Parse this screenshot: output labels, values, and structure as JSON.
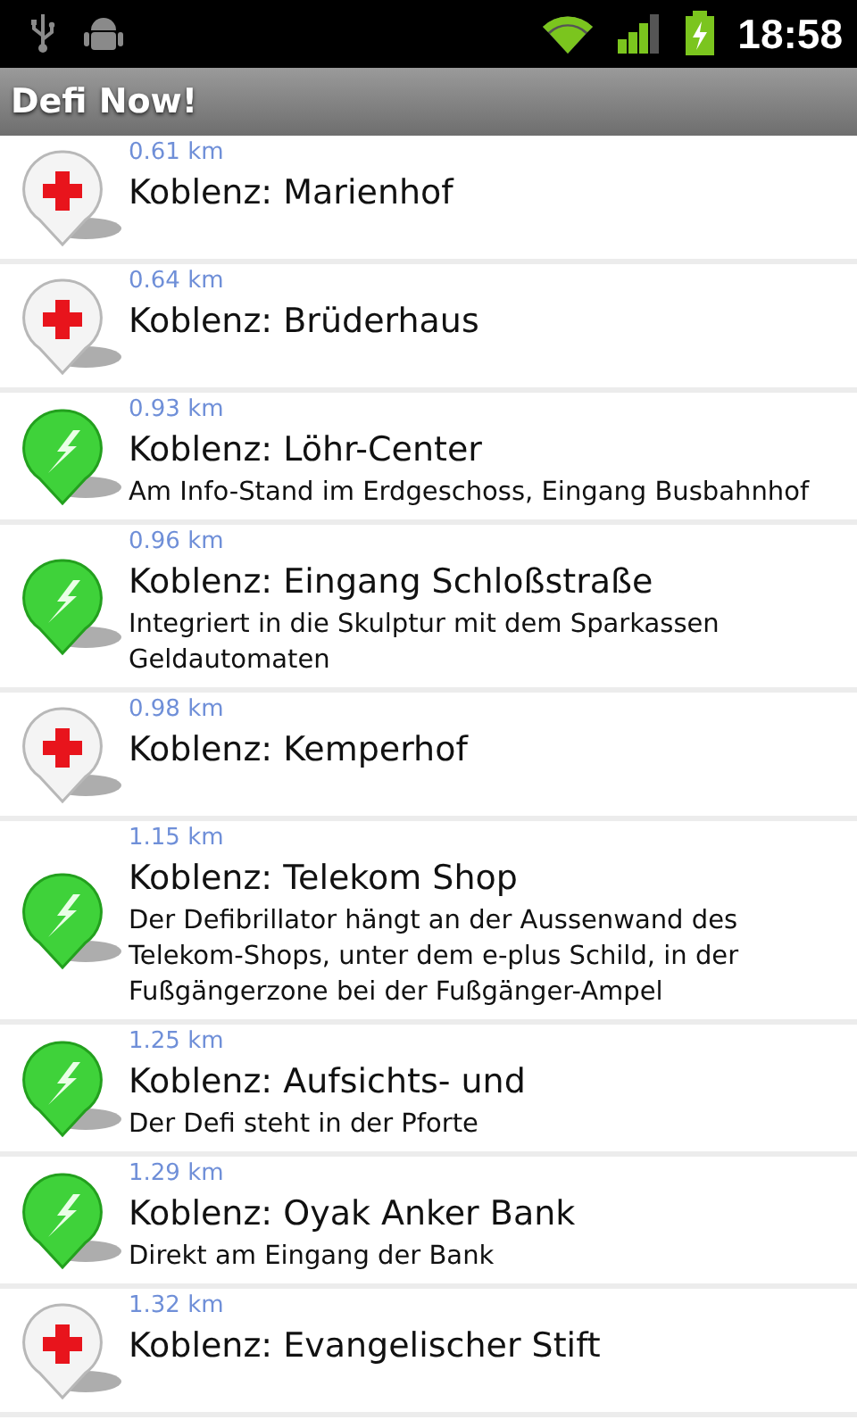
{
  "status_bar": {
    "time": "18:58"
  },
  "app_bar": {
    "title": "Defi Now!"
  },
  "locations": [
    {
      "kind": "hospital",
      "distance": "0.61 km",
      "name": "Koblenz: Marienhof"
    },
    {
      "kind": "hospital",
      "distance": "0.64 km",
      "name": "Koblenz: Brüderhaus"
    },
    {
      "kind": "defibrillator",
      "distance": "0.93 km",
      "name": "Koblenz: Löhr-Center",
      "description": "Am Info-Stand im Erdgeschoss, Eingang Busbahnhof"
    },
    {
      "kind": "defibrillator",
      "distance": "0.96 km",
      "name": "Koblenz: Eingang Schloßstraße",
      "description": "Integriert in die Skulptur mit dem Sparkassen Geldautomaten"
    },
    {
      "kind": "hospital",
      "distance": "0.98 km",
      "name": "Koblenz: Kemperhof"
    },
    {
      "kind": "defibrillator",
      "distance": "1.15 km",
      "name": "Koblenz: Telekom Shop",
      "description": "Der Defibrillator hängt an der Aussenwand des Telekom-Shops, unter dem e-plus Schild, in der Fußgängerzone bei der Fußgänger-Ampel"
    },
    {
      "kind": "defibrillator",
      "distance": "1.25 km",
      "name": "Koblenz: Aufsichts- und",
      "description": "Der Defi steht in der Pforte"
    },
    {
      "kind": "defibrillator",
      "distance": "1.29 km",
      "name": "Koblenz: Oyak Anker Bank",
      "description": "Direkt am Eingang der Bank"
    },
    {
      "kind": "hospital",
      "distance": "1.32 km",
      "name": "Koblenz: Evangelischer Stift"
    }
  ]
}
